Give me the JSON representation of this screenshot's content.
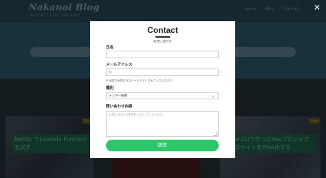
{
  "background": {
    "logo": "Nakanoi Blog",
    "tagline": "NAKANOI BLOG NAKANOI",
    "nav": [
      "Home",
      "Blog",
      "Contact"
    ],
    "cards": [
      {
        "ribbon": "Blog",
        "title": "Netlify でLambda Function を試す"
      },
      {
        "ribbon": "",
        "title": ""
      },
      {
        "ribbon": "Blog",
        "title": "Vue CLIで作ったVueプロジェクトのサイトをPWA化する"
      }
    ]
  },
  "close": {
    "symbol": "✕"
  },
  "modal": {
    "title": "Contact",
    "subtitle": "お問い合わせ",
    "name": {
      "label": "氏名",
      "placeholder": ""
    },
    "email": {
      "label": "メールアドレス",
      "placeholder": "例",
      "hint": "※ 返信が必要な方はメールアドレスをご入力ください"
    },
    "type": {
      "label": "種別",
      "selected": "メンター依頼"
    },
    "message": {
      "label": "問い合わせ内容",
      "placeholder": "お問い合わせ内容を入力してください。"
    },
    "submit_label": "送信"
  },
  "colors": {
    "accent": "#2dc76a",
    "overlay": "rgba(0,0,0,0.5)"
  }
}
